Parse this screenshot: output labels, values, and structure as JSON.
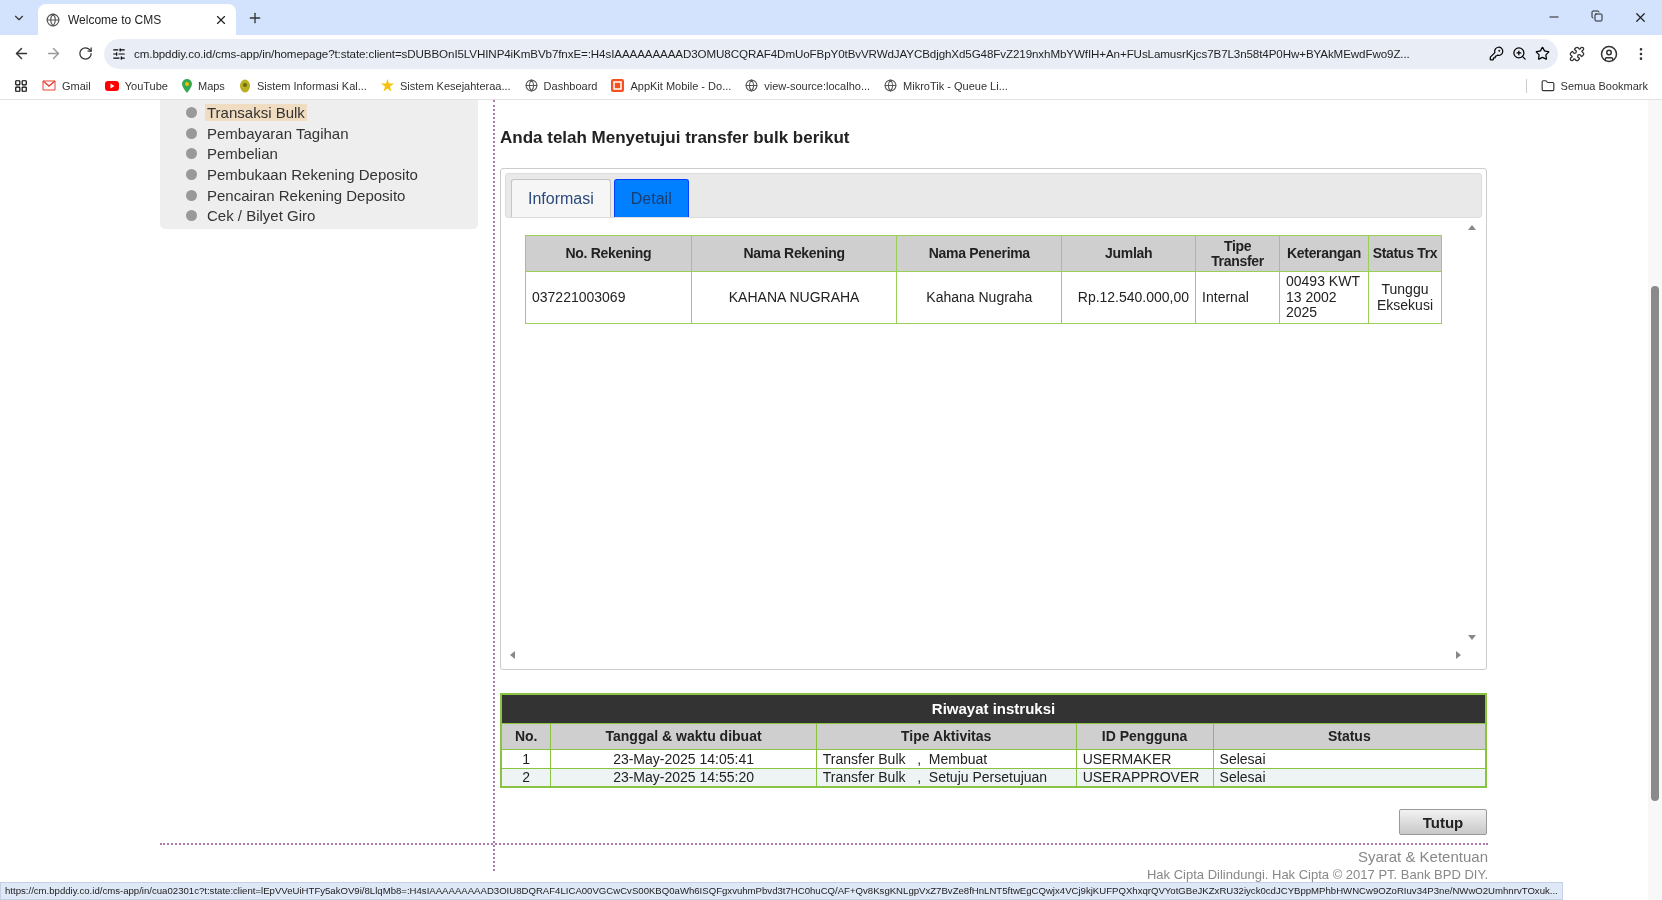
{
  "browser": {
    "tab_title": "Welcome to CMS",
    "url": "cm.bpddiy.co.id/cms-app/in/homepage?t:state:client=sDUBBOnI5LVHINP4iKmBVb7fnxE=:H4sIAAAAAAAAAD3OMU8CQRAF4DmUoFBpY0tBvVRWdJAYCBdjghXd5G48FvZ219nxhMbYWfIH+An+FUsLamusrKjcs7B7L3n58t4P0Hw+BYAkMEwdFwo9Z...",
    "bookmarks": [
      {
        "label": "Gmail",
        "kind": "gmail"
      },
      {
        "label": "YouTube",
        "kind": "youtube"
      },
      {
        "label": "Maps",
        "kind": "maps"
      },
      {
        "label": "Sistem Informasi Kal...",
        "kind": "app"
      },
      {
        "label": "Sistem Kesejahteraa...",
        "kind": "star"
      },
      {
        "label": "Dashboard",
        "kind": "globe"
      },
      {
        "label": "AppKit Mobile - Do...",
        "kind": "appkit"
      },
      {
        "label": "view-source:localho...",
        "kind": "globe"
      },
      {
        "label": "MikroTik - Queue Li...",
        "kind": "globe"
      }
    ],
    "all_bookmarks": "Semua Bookmark",
    "status_url": "https://cm.bpddiy.co.id/cms-app/in/cua02301c?t:state:client=lEpVVeUiHTFy5akOV9i/8LlqMb8=:H4sIAAAAAAAAAD3OIU8DQRAF4LICA00VGCwCvS00KBQ0aWh6ISQFgxvuhmPbvd3t7HC0huCQ/AF+Qv8KsgKNLgpVxZ7BvZe8fHnLNT5ftwEgCQwjx4VCj9kjKUFPQXhxqrQVYotGBeJKZxRU32iyck0cdJCYBppMPhbHWNCw9OZoRIuv34P3ne/NWwO2UmhnrvTOxuk..."
  },
  "sidebar": {
    "items": [
      {
        "label": "Transaksi Bulk",
        "selected": true
      },
      {
        "label": "Pembayaran Tagihan",
        "selected": false
      },
      {
        "label": "Pembelian",
        "selected": false
      },
      {
        "label": "Pembukaan Rekening Deposito",
        "selected": false
      },
      {
        "label": "Pencairan Rekening Deposito",
        "selected": false
      },
      {
        "label": "Cek / Bilyet Giro",
        "selected": false
      }
    ]
  },
  "heading": "Anda telah Menyetujui transfer bulk berikut",
  "tabs": [
    {
      "label": "Informasi",
      "selected": false
    },
    {
      "label": "Detail",
      "selected": true
    }
  ],
  "detail_table": {
    "columns": [
      "No. Rekening",
      "Nama Rekening",
      "Nama Penerima",
      "Jumlah",
      "Tipe Transfer",
      "Keterangan",
      "Status Trx"
    ],
    "rows": [
      [
        "037221003069",
        "KAHANA NUGRAHA",
        "Kahana Nugraha",
        "Rp.12.540.000,00",
        "Internal",
        "00493 KWT 13 2002 2025",
        "Tunggu Eksekusi"
      ]
    ]
  },
  "history": {
    "title": "Riwayat instruksi",
    "columns": [
      "No.",
      "Tanggal & waktu dibuat",
      "Tipe Aktivitas",
      "ID Pengguna",
      "Status"
    ],
    "rows": [
      [
        "1",
        "23-May-2025 14:05:41",
        "Transfer Bulk   ,  Membuat",
        "USERMAKER",
        "Selesai"
      ],
      [
        "2",
        "23-May-2025 14:55:20",
        "Transfer Bulk   ,  Setuju Persetujuan",
        "USERAPPROVER",
        "Selesai"
      ]
    ]
  },
  "close_button": "Tutup",
  "footer": {
    "terms": "Syarat & Ketentuan",
    "copyright": "Hak Cipta Dilindungi. Hak Cipta © 2017 PT. Bank BPD DIY."
  }
}
